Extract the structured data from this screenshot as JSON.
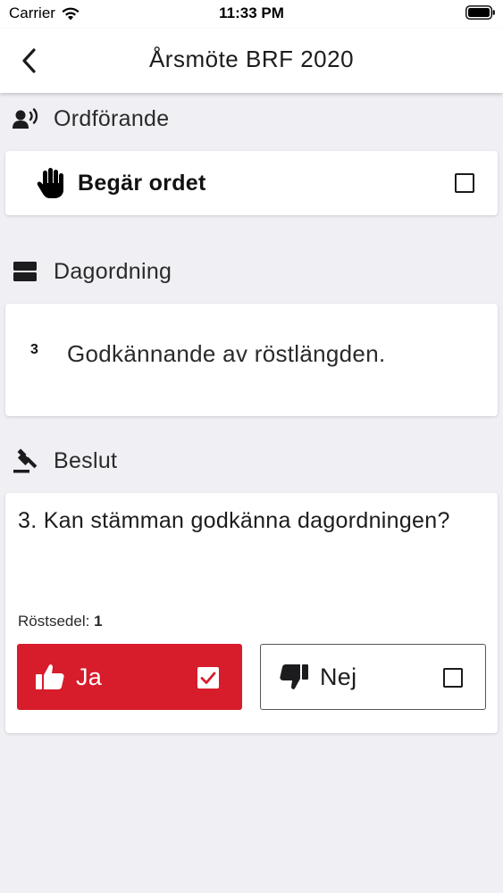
{
  "status_bar": {
    "carrier": "Carrier",
    "time": "11:33 PM"
  },
  "nav": {
    "title": "Årsmöte BRF 2020",
    "back_icon": "chevron-left-icon"
  },
  "chair": {
    "section_title": "Ordförande",
    "section_icon": "speaker-person-icon",
    "request_label": "Begär ordet",
    "request_icon": "raised-hand-icon",
    "request_checked": false
  },
  "agenda": {
    "section_title": "Dagordning",
    "section_icon": "agenda-list-icon",
    "item_number": "3",
    "item_text": "Godkännande av röstlängden."
  },
  "decision": {
    "section_title": "Beslut",
    "section_icon": "gavel-icon",
    "question": "3. Kan stämman godkänna dagordningen?",
    "ballot_label": "Röstsedel:",
    "ballot_value": "1",
    "yes": {
      "label": "Ja",
      "icon": "thumbs-up-icon",
      "checked": true
    },
    "no": {
      "label": "Nej",
      "icon": "thumbs-down-icon",
      "checked": false
    }
  },
  "colors": {
    "accent": "#d71c2b",
    "background": "#efeff4",
    "card": "#ffffff"
  }
}
